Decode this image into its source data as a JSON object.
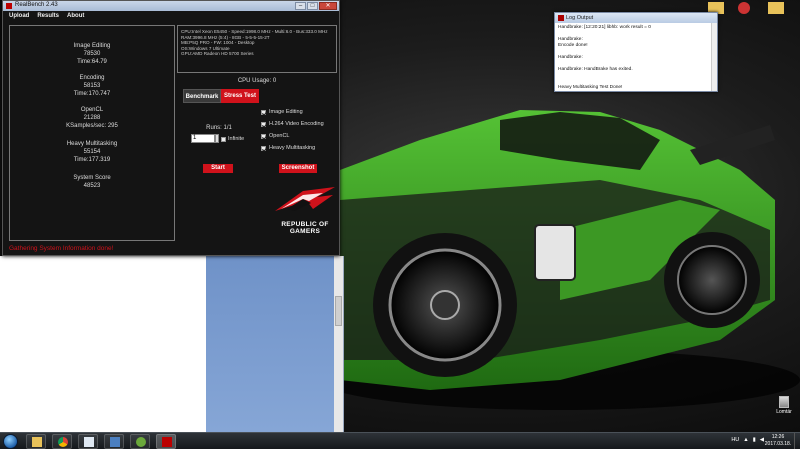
{
  "realbench": {
    "title": "RealBench 2.43",
    "menu": [
      "Upload",
      "Results",
      "About"
    ],
    "results": [
      {
        "name": "Image Editing",
        "score": "78530",
        "time": "Time:64.79"
      },
      {
        "name": "Encoding",
        "score": "58153",
        "time": "Time:170.747"
      },
      {
        "name": "OpenCL",
        "score": "21288",
        "time": "KSamples/sec: 295"
      },
      {
        "name": "Heavy Multitasking",
        "score": "55154",
        "time": "Time:177.319"
      },
      {
        "name": "System Score",
        "score": "48523",
        "time": ""
      }
    ],
    "sysinfo": [
      "CPU:Intel Xeon E5450 - Speed:1998.0 MHz - Multi:6.0 - Bus:333.0 MHz",
      "RAM:3996.8 MHz (5:4) - 8GB - 5-5-5-15-2T",
      "MB:P5Q PRO - FW: 1004 - Desktop",
      "OS:Windows 7 Ultimate",
      "GPU:AMD Radeon HD 5700 Series"
    ],
    "cpu_usage": "CPU Usage: 0",
    "tabs": {
      "benchmark": "Benchmark",
      "stress": "Stress Test"
    },
    "checks": [
      {
        "label": "Image Editing",
        "checked": true
      },
      {
        "label": "H.264 Video Encoding",
        "checked": true
      },
      {
        "label": "OpenCL",
        "checked": true
      },
      {
        "label": "Heavy Multitasking",
        "checked": true
      }
    ],
    "runs_label": "Runs: 1/1",
    "runs_value": "1",
    "infinite_label": "Infinite",
    "start_label": "Start",
    "screenshot_label": "Screenshot",
    "rog_line1": "REPUBLIC OF",
    "rog_line2": "GAMERS",
    "status": "Gathering System Information done!"
  },
  "log": {
    "title": "Log Output",
    "lines": [
      "Handbrake: [12:20:21] libhb: work result = 0",
      "",
      "Handbrake:",
      "Encode done!",
      "",
      "Handbrake:",
      "",
      "Handbrake: HandBrake has exited.",
      "",
      "",
      "Heavy Multitasking Test Done!"
    ]
  },
  "desktop": {
    "recycle_label": "Lomtár"
  },
  "taskbar": {
    "lang": "HU",
    "time": "12:26",
    "date": "2017.03.18."
  },
  "colors": {
    "accent": "#d0121b",
    "car_green": "#3fa326"
  }
}
